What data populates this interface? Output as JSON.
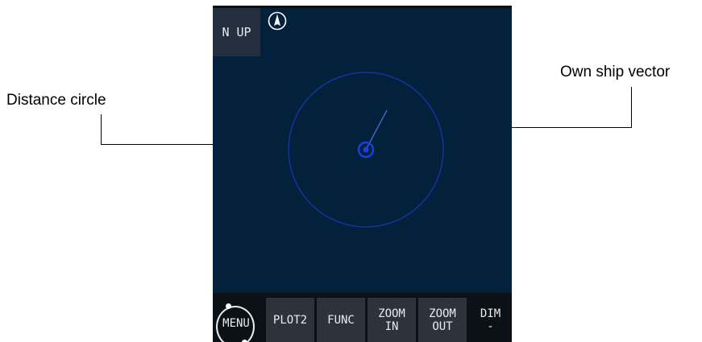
{
  "annotations": {
    "distance_circle": "Distance circle",
    "own_ship_vector": "Own ship vector"
  },
  "display": {
    "orientation_mode": "N UP",
    "north_icon": "north-arrow-icon",
    "softkeys": [
      {
        "line1": "MENU",
        "line2": ""
      },
      {
        "line1": "PLOT2",
        "line2": ""
      },
      {
        "line1": "FUNC",
        "line2": ""
      },
      {
        "line1": "ZOOM",
        "line2": "IN"
      },
      {
        "line1": "ZOOM",
        "line2": "OUT"
      },
      {
        "line1": "DIM",
        "line2": "-"
      }
    ]
  },
  "colors": {
    "screen_background": "#03213a",
    "distance_circle": "#1a2fa0",
    "own_ship": "#1b3fe0",
    "vector": "#3a64c8",
    "softkey_background": "#2c333b"
  }
}
